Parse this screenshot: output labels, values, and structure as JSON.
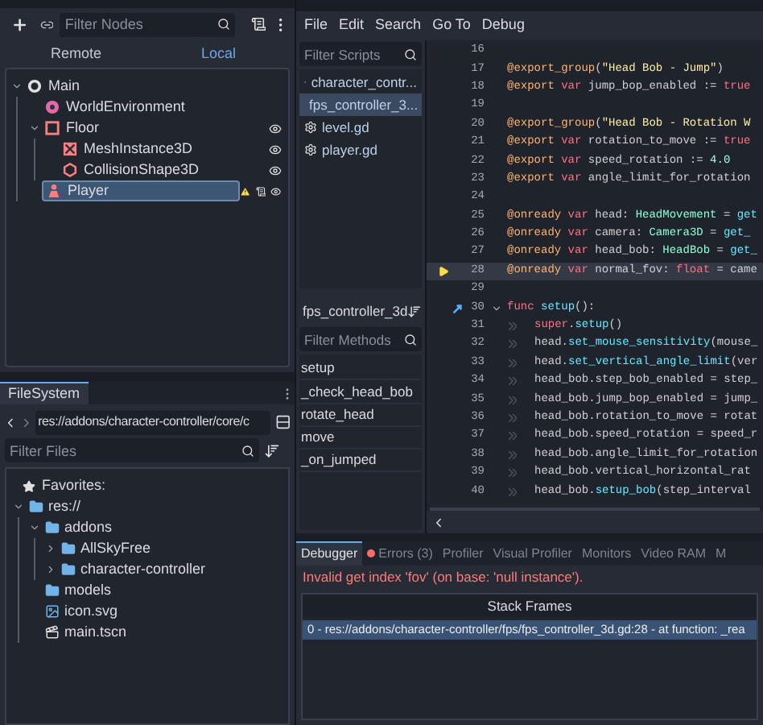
{
  "scene_dock": {
    "filter": {
      "placeholder": "Filter Nodes"
    },
    "view_tabs": [
      {
        "label": "Remote",
        "selected": false
      },
      {
        "label": "Local",
        "selected": true
      }
    ],
    "tree": [
      {
        "name": "Main",
        "kind": "node3d",
        "expanded": true,
        "eye": false,
        "selected": false,
        "warning": false,
        "script": false,
        "children": [
          {
            "name": "WorldEnvironment",
            "kind": "environment",
            "eye": false,
            "selected": false,
            "warning": false,
            "script": false
          },
          {
            "name": "Floor",
            "kind": "body",
            "expanded": true,
            "eye": true,
            "selected": false,
            "warning": false,
            "script": false,
            "children": [
              {
                "name": "MeshInstance3D",
                "kind": "mesh",
                "eye": true,
                "selected": false,
                "warning": false,
                "script": false
              },
              {
                "name": "CollisionShape3D",
                "kind": "collision",
                "eye": true,
                "selected": false,
                "warning": false,
                "script": false
              }
            ]
          },
          {
            "name": "Player",
            "kind": "character",
            "eye": true,
            "selected": true,
            "warning": true,
            "script": true
          }
        ]
      }
    ]
  },
  "filesystem": {
    "tab": "FileSystem",
    "path": "res://addons/character-controller/core/c",
    "filter": {
      "placeholder": "Filter Files"
    },
    "favorites": "Favorites:",
    "tree": [
      {
        "name": "res://",
        "kind": "folder",
        "expanded": true,
        "children": [
          {
            "name": "addons",
            "kind": "folder",
            "expanded": true,
            "children": [
              {
                "name": "AllSkyFree",
                "kind": "folder",
                "expanded": false
              },
              {
                "name": "character-controller",
                "kind": "folder",
                "expanded": false
              }
            ]
          },
          {
            "name": "models",
            "kind": "folder"
          },
          {
            "name": "icon.svg",
            "kind": "image"
          },
          {
            "name": "main.tscn",
            "kind": "scene"
          }
        ]
      }
    ]
  },
  "menu": [
    "File",
    "Edit",
    "Search",
    "Go To",
    "Debug"
  ],
  "scripts": {
    "filter": {
      "placeholder": "Filter Scripts"
    },
    "items": [
      {
        "name": "character_contr...",
        "selected": false
      },
      {
        "name": "fps_controller_3...",
        "selected": true
      },
      {
        "name": "level.gd",
        "selected": false
      },
      {
        "name": "player.gd",
        "selected": false
      }
    ]
  },
  "methods": {
    "title": "fps_controller_3d",
    "filter": {
      "placeholder": "Filter Methods"
    },
    "items": [
      "setup",
      "_check_head_bob",
      "rotate_head",
      "move",
      "_on_jumped"
    ]
  },
  "code": [
    {
      "number": "16",
      "kind": "plain",
      "indented": false,
      "fold": false,
      "current": false
    },
    {
      "number": "17",
      "kind": "plain",
      "indented": false,
      "fold": false,
      "current": false,
      "tokens": [
        {
          "kind": "annotation",
          "text": "@export_group"
        },
        {
          "kind": "plain",
          "text": "("
        },
        {
          "kind": "string",
          "text": "\"Head Bob - Jump\""
        },
        {
          "kind": "plain",
          "text": ")"
        }
      ]
    },
    {
      "number": "18",
      "kind": "plain",
      "indented": false,
      "fold": false,
      "current": false,
      "tokens": [
        {
          "kind": "annotation",
          "text": "@export"
        },
        {
          "kind": "keyword",
          "text": " var"
        },
        {
          "kind": "plain",
          "text": " jump_bop_enabled := "
        },
        {
          "kind": "keyword",
          "text": "true"
        }
      ]
    },
    {
      "number": "19",
      "kind": "plain",
      "indented": false,
      "fold": false,
      "current": false
    },
    {
      "number": "20",
      "kind": "plain",
      "indented": false,
      "fold": false,
      "current": false,
      "tokens": [
        {
          "kind": "annotation",
          "text": "@export_group"
        },
        {
          "kind": "plain",
          "text": "("
        },
        {
          "kind": "string",
          "text": "\"Head Bob - Rotation W"
        }
      ]
    },
    {
      "number": "21",
      "kind": "plain",
      "indented": false,
      "fold": false,
      "current": false,
      "tokens": [
        {
          "kind": "annotation",
          "text": "@export"
        },
        {
          "kind": "keyword",
          "text": " var"
        },
        {
          "kind": "plain",
          "text": " rotation_to_move := "
        },
        {
          "kind": "keyword",
          "text": "true"
        }
      ]
    },
    {
      "number": "22",
      "kind": "plain",
      "indented": false,
      "fold": false,
      "current": false,
      "tokens": [
        {
          "kind": "annotation",
          "text": "@export"
        },
        {
          "kind": "keyword",
          "text": " var"
        },
        {
          "kind": "plain",
          "text": " speed_rotation := "
        },
        {
          "kind": "number",
          "text": "4.0"
        }
      ]
    },
    {
      "number": "23",
      "kind": "plain",
      "indented": false,
      "fold": false,
      "current": false,
      "tokens": [
        {
          "kind": "annotation",
          "text": "@export"
        },
        {
          "kind": "keyword",
          "text": " var"
        },
        {
          "kind": "plain",
          "text": " angle_limit_for_rotation"
        }
      ]
    },
    {
      "number": "24",
      "kind": "plain",
      "indented": false,
      "fold": false,
      "current": false
    },
    {
      "number": "25",
      "kind": "plain",
      "indented": false,
      "fold": false,
      "current": false,
      "tokens": [
        {
          "kind": "annotation",
          "text": "@onready"
        },
        {
          "kind": "keyword",
          "text": " var"
        },
        {
          "kind": "plain",
          "text": " head: "
        },
        {
          "kind": "type",
          "text": "HeadMovement"
        },
        {
          "kind": "plain",
          "text": " = "
        },
        {
          "kind": "function",
          "text": "get"
        }
      ]
    },
    {
      "number": "26",
      "kind": "plain",
      "indented": false,
      "fold": false,
      "current": false,
      "tokens": [
        {
          "kind": "annotation",
          "text": "@onready"
        },
        {
          "kind": "keyword",
          "text": " var"
        },
        {
          "kind": "plain",
          "text": " camera: "
        },
        {
          "kind": "type",
          "text": "Camera3D"
        },
        {
          "kind": "plain",
          "text": " = "
        },
        {
          "kind": "function",
          "text": "get_"
        }
      ]
    },
    {
      "number": "27",
      "kind": "plain",
      "indented": false,
      "fold": false,
      "current": false,
      "tokens": [
        {
          "kind": "annotation",
          "text": "@onready"
        },
        {
          "kind": "keyword",
          "text": " var"
        },
        {
          "kind": "plain",
          "text": " head_bob: "
        },
        {
          "kind": "type",
          "text": "HeadBob"
        },
        {
          "kind": "plain",
          "text": " = "
        },
        {
          "kind": "function",
          "text": "get_"
        }
      ]
    },
    {
      "number": "28",
      "kind": "arrow",
      "indented": false,
      "fold": false,
      "current": true,
      "tokens": [
        {
          "kind": "annotation",
          "text": "@onready"
        },
        {
          "kind": "keyword",
          "text": " var"
        },
        {
          "kind": "plain",
          "text": " normal_fov: "
        },
        {
          "kind": "keyword",
          "text": "float"
        },
        {
          "kind": "plain",
          "text": " = came"
        }
      ]
    },
    {
      "number": "29",
      "kind": "plain",
      "indented": false,
      "fold": false,
      "current": false
    },
    {
      "number": "30",
      "kind": "override",
      "indented": false,
      "fold": true,
      "current": false,
      "tokens": [
        {
          "kind": "keyword",
          "text": "func"
        },
        {
          "kind": "function",
          "text": " setup"
        },
        {
          "kind": "plain",
          "text": "():"
        }
      ]
    },
    {
      "number": "31",
      "kind": "plain",
      "indented": true,
      "fold": false,
      "current": false,
      "tokens": [
        {
          "kind": "keyword",
          "text": "super"
        },
        {
          "kind": "plain",
          "text": "."
        },
        {
          "kind": "function",
          "text": "setup"
        },
        {
          "kind": "plain",
          "text": "()"
        }
      ]
    },
    {
      "number": "32",
      "kind": "plain",
      "indented": true,
      "fold": false,
      "current": false,
      "tokens": [
        {
          "kind": "plain",
          "text": "head."
        },
        {
          "kind": "function",
          "text": "set_mouse_sensitivity"
        },
        {
          "kind": "plain",
          "text": "(mouse_"
        }
      ]
    },
    {
      "number": "33",
      "kind": "plain",
      "indented": true,
      "fold": false,
      "current": false,
      "tokens": [
        {
          "kind": "plain",
          "text": "head."
        },
        {
          "kind": "function",
          "text": "set_vertical_angle_limit"
        },
        {
          "kind": "plain",
          "text": "(ver"
        }
      ]
    },
    {
      "number": "34",
      "kind": "plain",
      "indented": true,
      "fold": false,
      "current": false,
      "tokens": [
        {
          "kind": "plain",
          "text": "head_bob.step_bob_enabled = step_"
        }
      ]
    },
    {
      "number": "35",
      "kind": "plain",
      "indented": true,
      "fold": false,
      "current": false,
      "tokens": [
        {
          "kind": "plain",
          "text": "head_bob.jump_bop_enabled = jump_"
        }
      ]
    },
    {
      "number": "36",
      "kind": "plain",
      "indented": true,
      "fold": false,
      "current": false,
      "tokens": [
        {
          "kind": "plain",
          "text": "head_bob.rotation_to_move = rotat"
        }
      ]
    },
    {
      "number": "37",
      "kind": "plain",
      "indented": true,
      "fold": false,
      "current": false,
      "tokens": [
        {
          "kind": "plain",
          "text": "head_bob.speed_rotation = speed_r"
        }
      ]
    },
    {
      "number": "38",
      "kind": "plain",
      "indented": true,
      "fold": false,
      "current": false,
      "tokens": [
        {
          "kind": "plain",
          "text": "head_bob.angle_limit_for_rotation"
        }
      ]
    },
    {
      "number": "39",
      "kind": "plain",
      "indented": true,
      "fold": false,
      "current": false,
      "tokens": [
        {
          "kind": "plain",
          "text": "head_bob.vertical_horizontal_rat"
        }
      ]
    },
    {
      "number": "40",
      "kind": "plain",
      "indented": true,
      "fold": false,
      "current": false,
      "tokens": [
        {
          "kind": "plain",
          "text": "head_bob."
        },
        {
          "kind": "function",
          "text": "setup_bob"
        },
        {
          "kind": "plain",
          "text": "(step_interval"
        }
      ]
    }
  ],
  "debugger": {
    "tabs": [
      {
        "label": "Debugger",
        "selected": true,
        "kind": "plain"
      },
      {
        "label": "Errors (3)",
        "selected": false,
        "kind": "errors"
      },
      {
        "label": "Profiler",
        "selected": false,
        "kind": "plain"
      },
      {
        "label": "Visual Profiler",
        "selected": false,
        "kind": "plain"
      },
      {
        "label": "Monitors",
        "selected": false,
        "kind": "plain"
      },
      {
        "label": "Video RAM",
        "selected": false,
        "kind": "plain"
      },
      {
        "label": "M",
        "selected": false,
        "kind": "plain"
      }
    ],
    "error": "Invalid get index 'fov' (on base: 'null instance').",
    "stack_title": "Stack Frames",
    "frames": [
      {
        "text": "0 - res://addons/character-controller/fps/fps_controller_3d.gd:28 - at function: _rea",
        "selected": true
      }
    ]
  }
}
